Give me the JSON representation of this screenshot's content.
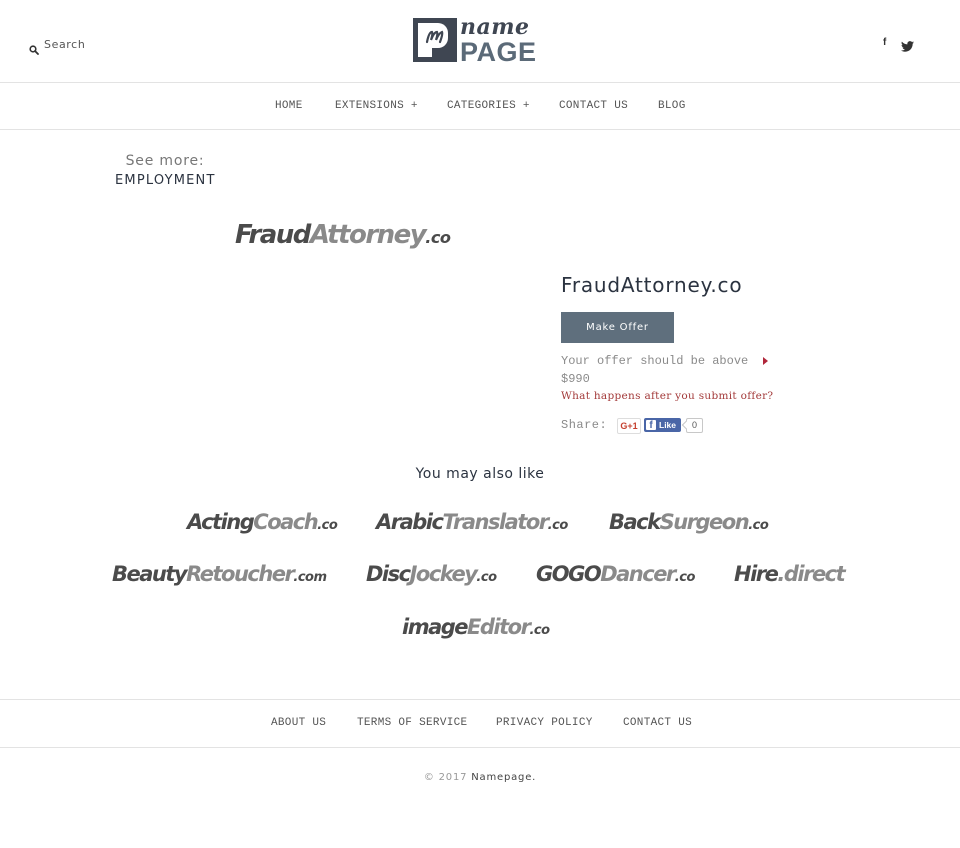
{
  "header": {
    "search_label": "Search",
    "search_icon": "search-icon",
    "logo": {
      "name": "name",
      "page": "PAGE",
      "monogram": "n"
    },
    "social": [
      {
        "name": "facebook",
        "icon": "facebook-icon",
        "glyph": "f"
      },
      {
        "name": "twitter",
        "icon": "twitter-icon"
      }
    ]
  },
  "nav": {
    "items": [
      {
        "label": "HOME"
      },
      {
        "label": "EXTENSIONS +"
      },
      {
        "label": "CATEGORIES +"
      },
      {
        "label": "CONTACT US"
      },
      {
        "label": "BLOG"
      }
    ]
  },
  "see_more": {
    "label": "See more:",
    "category": "EMPLOYMENT"
  },
  "domain": {
    "logo": {
      "dark": "Fraud",
      "light": "Attorney",
      "ext": ".co"
    },
    "title": "FraudAttorney.co",
    "make_offer_label": "Make Offer",
    "offer_note": "Your offer should be above $990",
    "what_happens": "What happens after you submit offer?",
    "share_label": "Share:",
    "gplus_label": "G+1",
    "fb_like_label": "Like",
    "fb_glyph": "f",
    "fb_count": "0"
  },
  "related": {
    "heading": "You may also like",
    "items": [
      {
        "dark": "Acting",
        "light": "Coach",
        "ext": ".co"
      },
      {
        "dark": "Arabic",
        "light": "Translator",
        "ext": ".co"
      },
      {
        "dark": "Back",
        "light": "Surgeon",
        "ext": ".co"
      },
      {
        "dark": "Beauty",
        "light": "Retoucher",
        "ext": ".com"
      },
      {
        "dark": "Disc",
        "light": "Jockey",
        "ext": ".co"
      },
      {
        "dark": "GOGO",
        "light": "Dancer",
        "ext": ".co"
      },
      {
        "dark": "Hire",
        "light": ".direct",
        "ext": ""
      },
      {
        "dark": "image",
        "light": "Editor",
        "ext": ".co"
      }
    ]
  },
  "footer": {
    "links": [
      {
        "label": "ABOUT US"
      },
      {
        "label": "TERMS OF SERVICE"
      },
      {
        "label": "PRIVACY POLICY"
      },
      {
        "label": "CONTACT US"
      }
    ],
    "copyright": "© 2017",
    "brand": "Namepage."
  },
  "colors": {
    "logo_dark": "#3f4652",
    "logo_page": "#5b6a78",
    "button_bg": "#5f6f7d",
    "link_red": "#a33a3a",
    "fb_blue": "#4a66a7",
    "gplus_red": "#c5402f"
  }
}
